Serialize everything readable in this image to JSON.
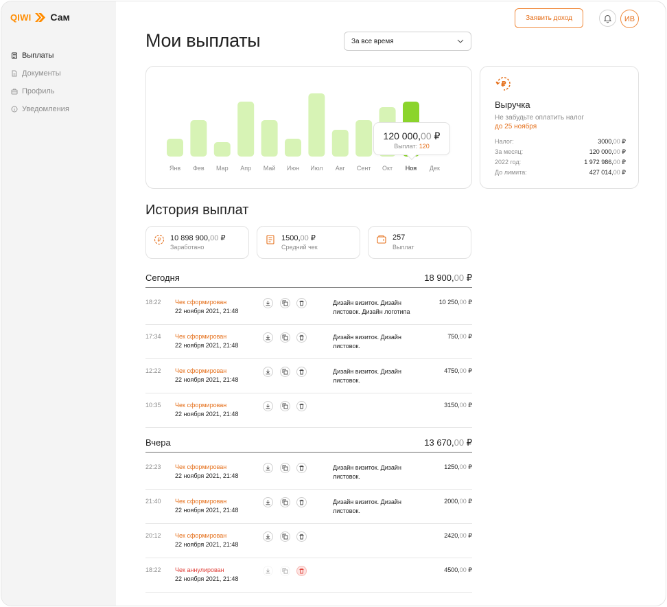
{
  "brand": {
    "name": "QIWI",
    "product": "Сам"
  },
  "sidebar": {
    "items": [
      {
        "label": "Выплаты",
        "icon": "receipt-icon",
        "active": true
      },
      {
        "label": "Документы",
        "icon": "document-icon",
        "active": false
      },
      {
        "label": "Профиль",
        "icon": "briefcase-icon",
        "active": false
      },
      {
        "label": "Уведомления",
        "icon": "info-icon",
        "active": false
      }
    ]
  },
  "header": {
    "title": "Мои выплаты",
    "period": "За все время",
    "income_button": "Заявить доход",
    "avatar_initials": "ИВ"
  },
  "chart_data": {
    "type": "bar",
    "categories": [
      "Янв",
      "Фев",
      "Мар",
      "Апр",
      "Май",
      "Июн",
      "Июл",
      "Авг",
      "Сент",
      "Окт",
      "Ноя",
      "Дек"
    ],
    "values": [
      26,
      53,
      21,
      80,
      53,
      26,
      92,
      39,
      53,
      72,
      80,
      0
    ],
    "selected_index": 10,
    "colors": {
      "bar": "#d7f3b5",
      "selected": "#8bd42c"
    }
  },
  "tooltip": {
    "amount_main": "120 000,",
    "amount_dec": "00",
    "currency": "₽",
    "count_label": "Выплат:",
    "count": "120"
  },
  "revenue": {
    "title": "Выручка",
    "subtitle": "Не забудьте оплатить налог",
    "deadline": "до 25 ноября",
    "rows": [
      {
        "label": "Налог:",
        "main": "3000,",
        "dec": "00",
        "cur": "₽"
      },
      {
        "label": "За месяц:",
        "main": "120 000,",
        "dec": "00",
        "cur": "₽"
      },
      {
        "label": "2022 год:",
        "main": "1 972 986,",
        "dec": "00",
        "cur": "₽"
      },
      {
        "label": "До лимита:",
        "main": "427 014,",
        "dec": "00",
        "cur": "₽"
      }
    ]
  },
  "history": {
    "title": "История выплат",
    "stats": [
      {
        "main": "10 898 900,",
        "dec": "00",
        "cur": "₽",
        "label": "Заработано",
        "icon": "ruble-coin-icon"
      },
      {
        "main": "1500,",
        "dec": "00",
        "cur": "₽",
        "label": "Средний чек",
        "icon": "receipt-icon"
      },
      {
        "main": "257",
        "dec": "",
        "cur": "",
        "label": "Выплат",
        "icon": "wallet-icon"
      }
    ],
    "groups": [
      {
        "name": "Сегодня",
        "sum_main": "18 900,",
        "sum_dec": "00",
        "cur": "₽",
        "rows": [
          {
            "time": "18:22",
            "status": "Чек сформирован",
            "date": "22 ноября 2021, 21:48",
            "desc1": "Дизайн визиток. Дизайн",
            "desc2": "листовок. Дизайн логотипа",
            "amount_main": "10 250,",
            "amount_dec": "00",
            "cur": "₽",
            "cancelled": false
          },
          {
            "time": "17:34",
            "status": "Чек сформирован",
            "date": "22 ноября 2021, 21:48",
            "desc1": "Дизайн визиток. Дизайн",
            "desc2": "листовок.",
            "amount_main": "750,",
            "amount_dec": "00",
            "cur": "₽",
            "cancelled": false
          },
          {
            "time": "12:22",
            "status": "Чек сформирован",
            "date": "22 ноября 2021, 21:48",
            "desc1": "Дизайн визиток. Дизайн",
            "desc2": "листовок.",
            "amount_main": "4750,",
            "amount_dec": "00",
            "cur": "₽",
            "cancelled": false
          },
          {
            "time": "10:35",
            "status": "Чек сформирован",
            "date": "22 ноября 2021, 21:48",
            "desc1": "",
            "desc2": "",
            "amount_main": "3150,",
            "amount_dec": "00",
            "cur": "₽",
            "cancelled": false
          }
        ]
      },
      {
        "name": "Вчера",
        "sum_main": "13 670,",
        "sum_dec": "00",
        "cur": "₽",
        "rows": [
          {
            "time": "22:23",
            "status": "Чек сформирован",
            "date": "22 ноября 2021, 21:48",
            "desc1": "Дизайн визиток. Дизайн",
            "desc2": "листовок.",
            "amount_main": "1250,",
            "amount_dec": "00",
            "cur": "₽",
            "cancelled": false
          },
          {
            "time": "21:40",
            "status": "Чек сформирован",
            "date": "22 ноября 2021, 21:48",
            "desc1": "Дизайн визиток. Дизайн",
            "desc2": "листовок.",
            "amount_main": "2000,",
            "amount_dec": "00",
            "cur": "₽",
            "cancelled": false
          },
          {
            "time": "20:12",
            "status": "Чек сформирован",
            "date": "22 ноября 2021, 21:48",
            "desc1": "",
            "desc2": "",
            "amount_main": "2420,",
            "amount_dec": "00",
            "cur": "₽",
            "cancelled": false
          },
          {
            "time": "18:22",
            "status": "Чек аннулирован",
            "date": "22 ноября 2021, 21:48",
            "desc1": "",
            "desc2": "",
            "amount_main": "4500,",
            "amount_dec": "00",
            "cur": "₽",
            "cancelled": true
          }
        ]
      }
    ]
  },
  "colors": {
    "accent": "#e56f1a",
    "danger": "#e0413a"
  }
}
